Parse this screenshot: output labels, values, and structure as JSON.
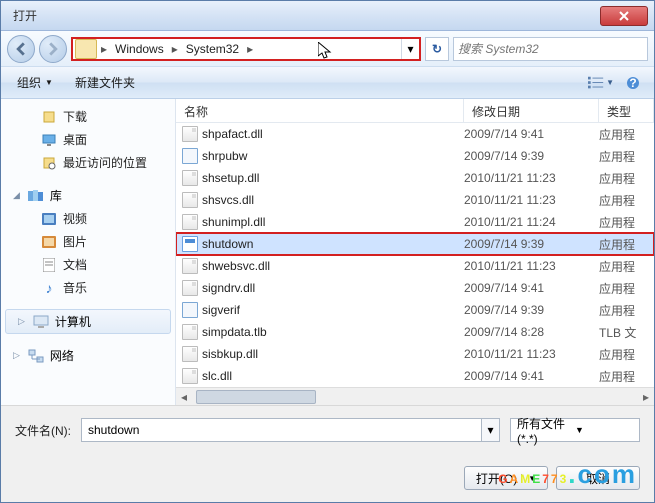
{
  "title": "打开",
  "breadcrumb": {
    "items": [
      "Windows",
      "System32"
    ]
  },
  "search": {
    "placeholder": "搜索 System32"
  },
  "toolbar": {
    "organize": "组织",
    "new_folder": "新建文件夹"
  },
  "sidebar": {
    "downloads": "下载",
    "desktop": "桌面",
    "recent": "最近访问的位置",
    "libraries": "库",
    "videos": "视频",
    "pictures": "图片",
    "documents": "文档",
    "music": "音乐",
    "computer": "计算机",
    "network": "网络"
  },
  "columns": {
    "name": "名称",
    "date": "修改日期",
    "type": "类型"
  },
  "files": [
    {
      "name": "shpafact.dll",
      "date": "2009/7/14 9:41",
      "type": "应用程",
      "icon": "dll"
    },
    {
      "name": "shrpubw",
      "date": "2009/7/14 9:39",
      "type": "应用程",
      "icon": "exe"
    },
    {
      "name": "shsetup.dll",
      "date": "2010/11/21 11:23",
      "type": "应用程",
      "icon": "dll"
    },
    {
      "name": "shsvcs.dll",
      "date": "2010/11/21 11:23",
      "type": "应用程",
      "icon": "dll"
    },
    {
      "name": "shunimpl.dll",
      "date": "2010/11/21 11:24",
      "type": "应用程",
      "icon": "dll"
    },
    {
      "name": "shutdown",
      "date": "2009/7/14 9:39",
      "type": "应用程",
      "icon": "exe2",
      "selected": true,
      "highlight": true
    },
    {
      "name": "shwebsvc.dll",
      "date": "2010/11/21 11:23",
      "type": "应用程",
      "icon": "dll"
    },
    {
      "name": "signdrv.dll",
      "date": "2009/7/14 9:41",
      "type": "应用程",
      "icon": "dll"
    },
    {
      "name": "sigverif",
      "date": "2009/7/14 9:39",
      "type": "应用程",
      "icon": "exe"
    },
    {
      "name": "simpdata.tlb",
      "date": "2009/7/14 8:28",
      "type": "TLB 文",
      "icon": "dll"
    },
    {
      "name": "sisbkup.dll",
      "date": "2010/11/21 11:23",
      "type": "应用程",
      "icon": "dll"
    },
    {
      "name": "slc.dll",
      "date": "2009/7/14 9:41",
      "type": "应用程",
      "icon": "dll"
    }
  ],
  "footer": {
    "filename_label": "文件名(N):",
    "filename_value": "shutdown",
    "filter": "所有文件(*.*)",
    "open": "打开(O)",
    "cancel": "取消"
  },
  "watermark": "GAME773.com"
}
